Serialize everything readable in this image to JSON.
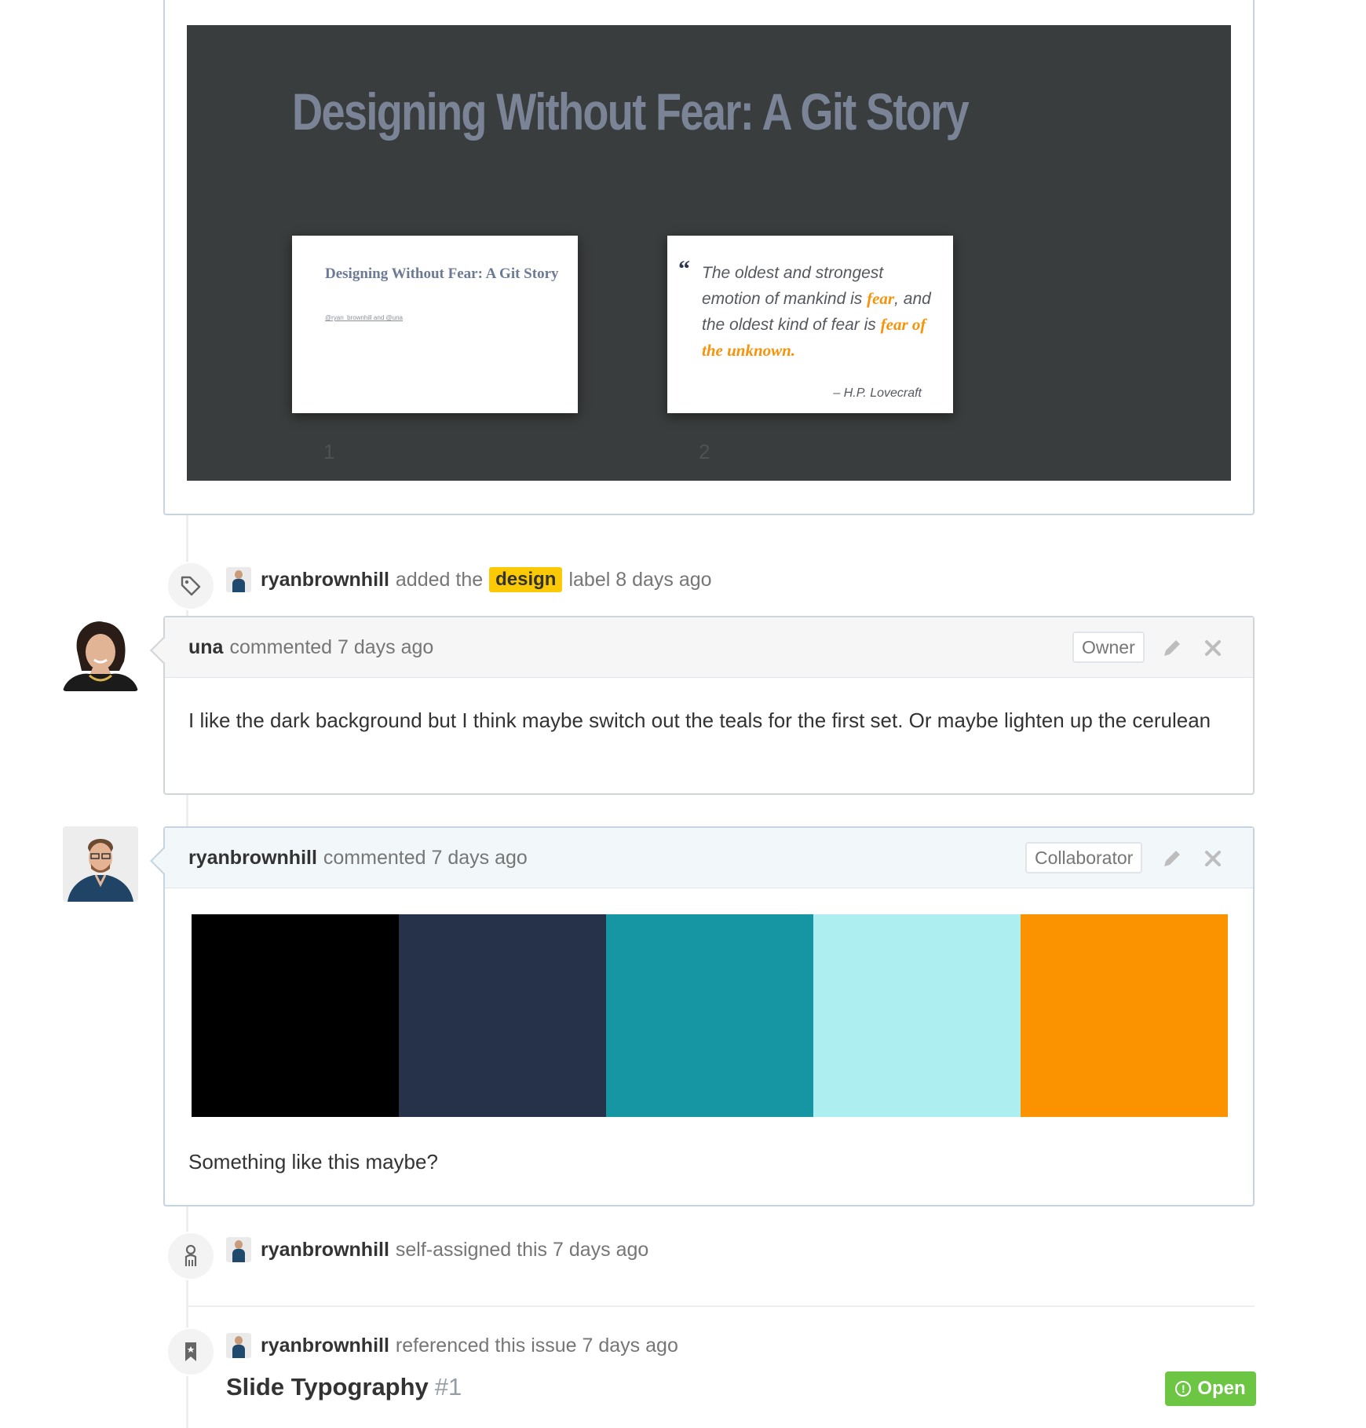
{
  "slide": {
    "title": "Designing Without Fear: A Git Story",
    "thumb1": {
      "title": "Designing Without Fear: A Git Story",
      "subtitle": "@ryan_brownhill and @una",
      "number": "1"
    },
    "thumb2": {
      "quote_mark": "“",
      "q1": "The oldest and strongest emotion of mankind is ",
      "q2": "fear",
      "q3": ", and the oldest kind of fear is ",
      "q4": "fear of the unknown.",
      "author": "– H.P. Lovecraft",
      "number": "2"
    }
  },
  "events": {
    "label_event": {
      "actor": "ryanbrownhill",
      "pre": "added the",
      "label": "design",
      "post": "label 8 days ago",
      "icon": "tag-icon"
    },
    "assign_event": {
      "actor": "ryanbrownhill",
      "text": "self-assigned this 7 days ago",
      "icon": "person-icon"
    },
    "ref_event": {
      "actor": "ryanbrownhill",
      "text": "referenced this issue 7 days ago",
      "icon": "bookmark-icon",
      "issue_title": "Slide Typography",
      "issue_number": "#1",
      "state": "Open"
    }
  },
  "comments": [
    {
      "author": "una",
      "meta": "commented 7 days ago",
      "role": "Owner",
      "body": "I like the dark background but I think maybe switch out the teals for the first set. Or maybe lighten up the cerulean"
    },
    {
      "author": "ryanbrownhill",
      "meta": "commented 7 days ago",
      "role": "Collaborator",
      "body": "Something like this maybe?",
      "swatches": [
        "#000000",
        "#26324a",
        "#1696a3",
        "#adeff0",
        "#fb9300"
      ]
    }
  ],
  "colors": {
    "label_design": "#fbca04",
    "open_green": "#6cc644",
    "accent_orange": "#f7930b"
  }
}
